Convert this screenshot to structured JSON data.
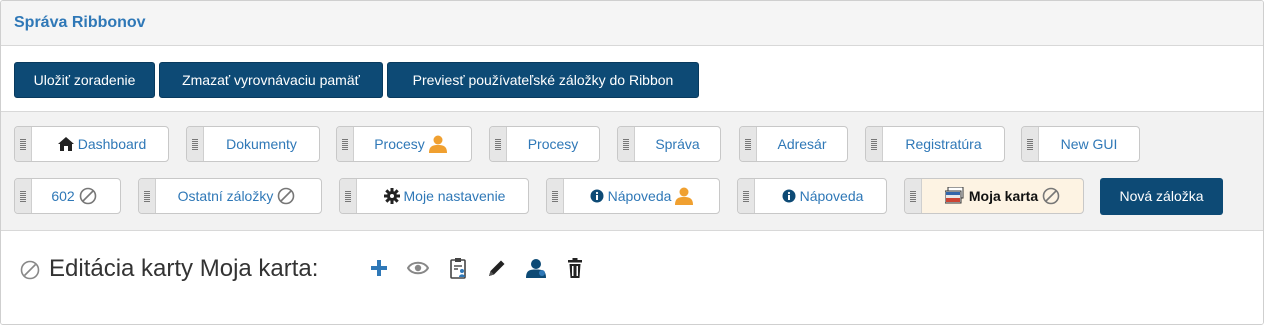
{
  "header": {
    "title": "Správa Ribbonov"
  },
  "toolbar": {
    "save_order": "Uložiť zoradenie",
    "clear_cache": "Zmazať vyrovnávaciu pamäť",
    "convert_tabs": "Previesť používateľské záložky do Ribbon"
  },
  "tabs": {
    "dashboard": "Dashboard",
    "dokumenty": "Dokumenty",
    "procesy_user": "Procesy",
    "procesy": "Procesy",
    "sprava": "Správa",
    "adresar": "Adresár",
    "registratura": "Registratúra",
    "new_gui": "New GUI",
    "t602": "602",
    "ostatne": "Ostatní záložky",
    "moje_nastavenie": "Moje nastavenie",
    "napoveda_user": "Nápoveda",
    "napoveda": "Nápoveda",
    "moja_karta": "Moja karta"
  },
  "new_tab_label": "Nová záložka",
  "editor": {
    "title": "Editácia karty Moja karta:"
  },
  "colors": {
    "primary": "#0d4a75",
    "link": "#2f78b7",
    "user_orange": "#f0a030",
    "active_tab_bg": "#fdf3e3"
  }
}
